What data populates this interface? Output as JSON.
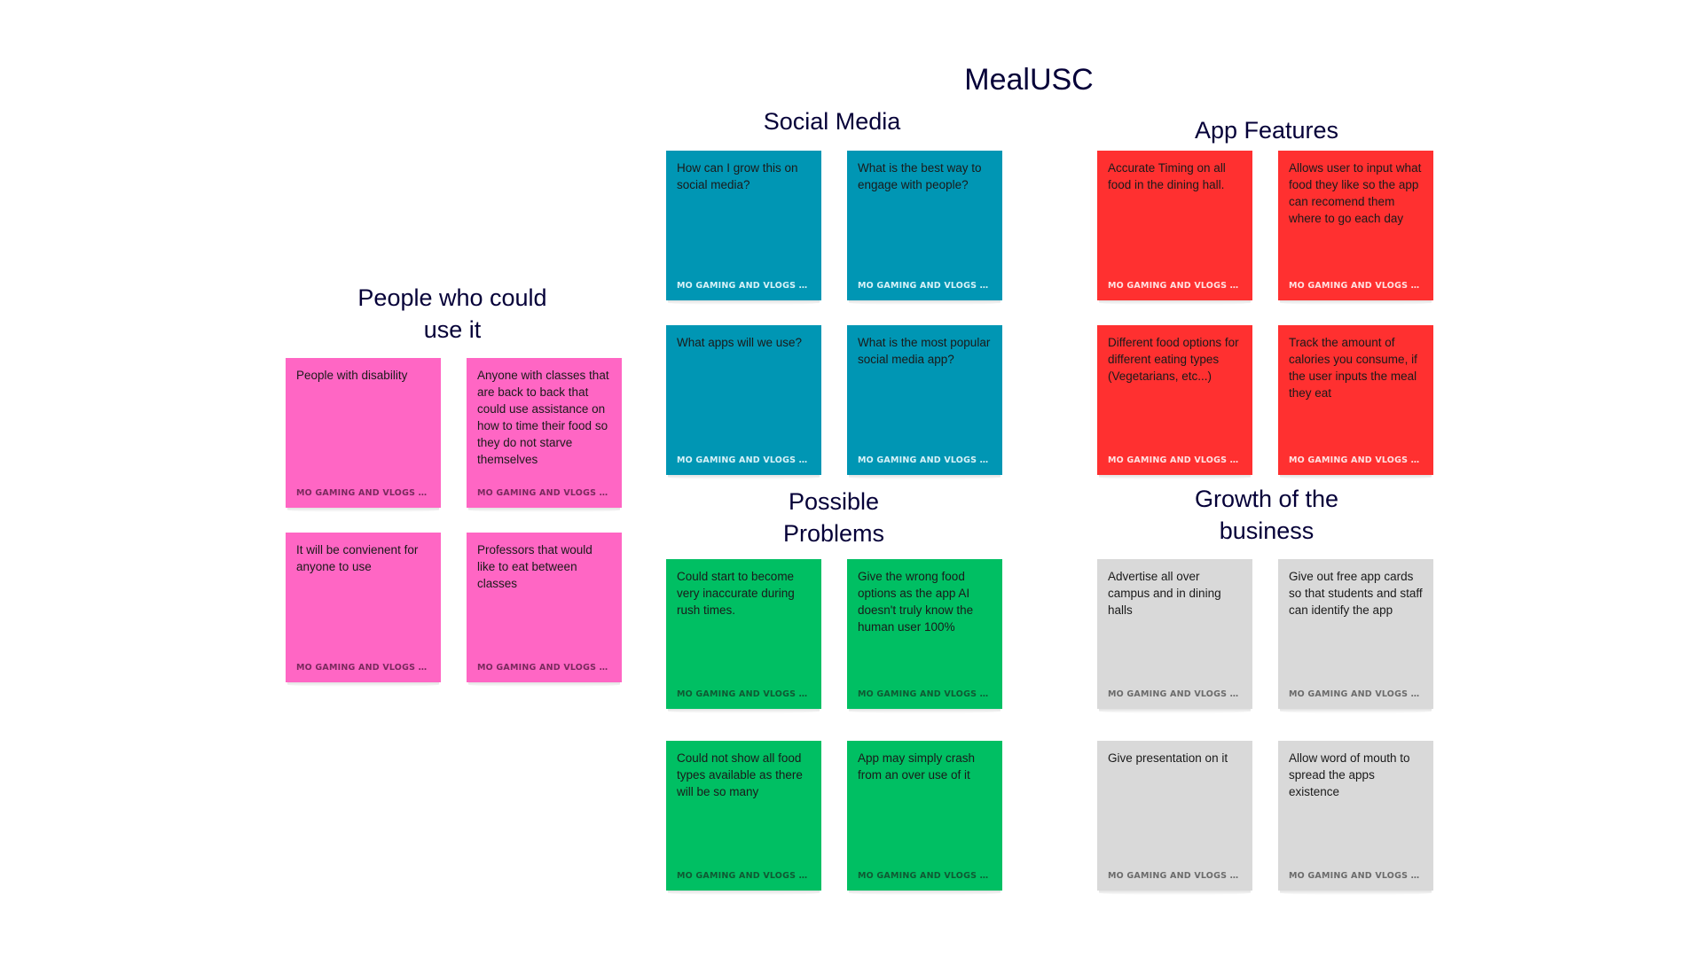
{
  "board": {
    "title": "MealUSC",
    "colors": {
      "pink": "#ff66c4",
      "teal": "#0096b4",
      "red": "#ff3030",
      "green": "#00bf63",
      "gray": "#d9d9d9",
      "title_text": "#050038"
    }
  },
  "sections": {
    "people": {
      "title_line1": "People who could",
      "title_line2": "use it",
      "notes": [
        {
          "text": "People with disability",
          "author": "MO GAMING AND VLOGS Wa..."
        },
        {
          "text": "Anyone with classes that are back to back that could use assistance on how to time their food so they do not starve themselves",
          "author": "MO GAMING AND VLOGS Wa..."
        },
        {
          "text": "It will be convienent for anyone to use",
          "author": "MO GAMING AND VLOGS Wa..."
        },
        {
          "text": "Professors that would like to eat between classes",
          "author": "MO GAMING AND VLOGS Wa..."
        }
      ]
    },
    "social": {
      "title": "Social Media",
      "notes": [
        {
          "text": "How can I grow this on social media?",
          "author": "MO GAMING AND VLOGS Wa..."
        },
        {
          "text": "What is the best way to engage with people?",
          "author": "MO GAMING AND VLOGS Wa..."
        },
        {
          "text": "What apps will we use?",
          "author": "MO GAMING AND VLOGS Wa..."
        },
        {
          "text": "What is the most popular social media app?",
          "author": "MO GAMING AND VLOGS Wa..."
        }
      ]
    },
    "features": {
      "title": "App Features",
      "notes": [
        {
          "text": "Accurate Timing on all food in the dining hall.",
          "author": "MO GAMING AND VLOGS Wa..."
        },
        {
          "text": "Allows user to input what food they like so the app can recomend them where to go each day",
          "author": "MO GAMING AND VLOGS Wa..."
        },
        {
          "text": "Different food options for different eating types (Vegetarians, etc...)",
          "author": "MO GAMING AND VLOGS Wa..."
        },
        {
          "text": "Track the amount of calories you consume, if the user inputs the meal they eat",
          "author": "MO GAMING AND VLOGS Wa..."
        }
      ]
    },
    "problems": {
      "title_line1": "Possible",
      "title_line2": "Problems",
      "notes": [
        {
          "text": "Could start to become very inaccurate during rush times.",
          "author": "MO GAMING AND VLOGS Wa..."
        },
        {
          "text": "Give the wrong food options as the app AI doesn't truly know the human user 100%",
          "author": "MO GAMING AND VLOGS Wa..."
        },
        {
          "text": "Could not show all food types available as there will be so many",
          "author": "MO GAMING AND VLOGS Wa..."
        },
        {
          "text": "App may simply crash from an over use of it",
          "author": "MO GAMING AND VLOGS Wa..."
        }
      ]
    },
    "growth": {
      "title_line1": "Growth of the",
      "title_line2": "business",
      "notes": [
        {
          "text": "Advertise all over campus and in dining halls",
          "author": "MO GAMING AND VLOGS Wa..."
        },
        {
          "text": "Give out free app cards so that students and staff can identify the app",
          "author": "MO GAMING AND VLOGS Wa..."
        },
        {
          "text": "Give presentation on it",
          "author": "MO GAMING AND VLOGS Wa..."
        },
        {
          "text": "Allow word of mouth to spread the apps existence",
          "author": "MO GAMING AND VLOGS Wa..."
        }
      ]
    }
  }
}
